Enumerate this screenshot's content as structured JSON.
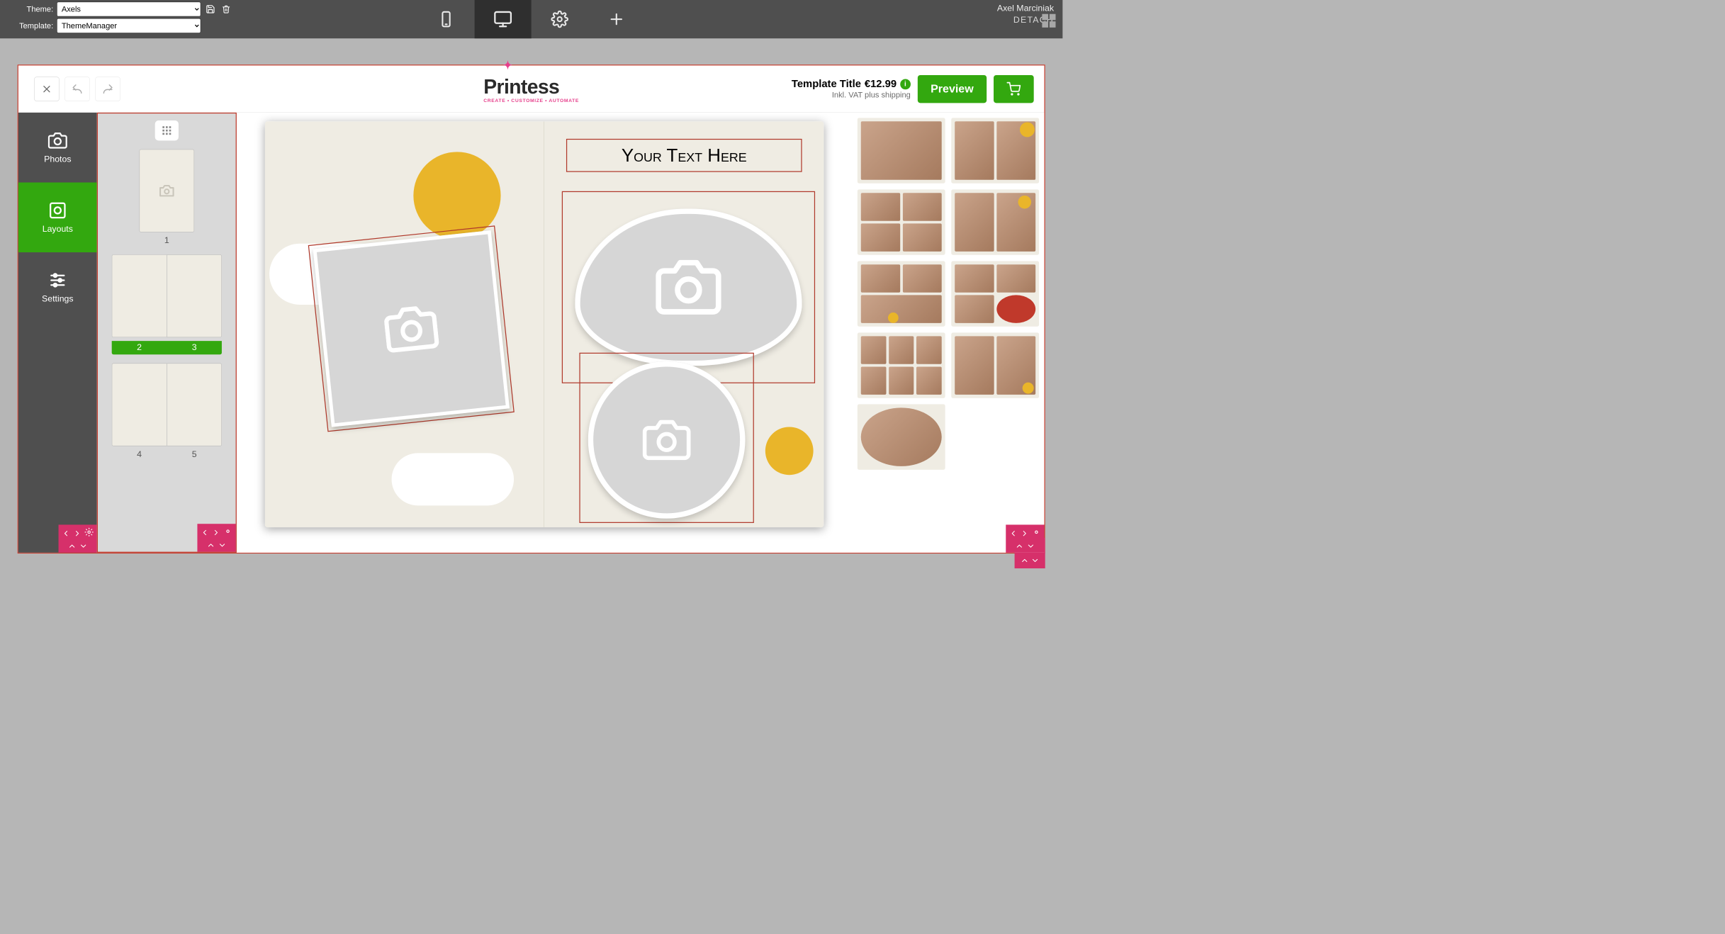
{
  "topbar": {
    "theme_label": "Theme:",
    "theme_value": "Axels",
    "template_label": "Template:",
    "template_value": "ThemeManager",
    "user_name": "Axel Marciniak",
    "detach_label": "DETACH"
  },
  "header": {
    "logo_text": "Printess",
    "logo_sub": "CREATE • CUSTOMIZE • AUTOMATE",
    "title": "Template Title",
    "price": "€12.99",
    "vat": "Inkl. VAT plus shipping",
    "preview_label": "Preview"
  },
  "sidebar": {
    "items": [
      {
        "id": "photos",
        "label": "Photos"
      },
      {
        "id": "layouts",
        "label": "Layouts"
      },
      {
        "id": "settings",
        "label": "Settings"
      }
    ],
    "active": "layouts"
  },
  "pages": [
    {
      "numbers": [
        "1"
      ],
      "type": "single",
      "active": false
    },
    {
      "numbers": [
        "2",
        "3"
      ],
      "type": "spread",
      "active": true
    },
    {
      "numbers": [
        "4",
        "5"
      ],
      "type": "spread",
      "active": false
    }
  ],
  "canvas": {
    "text_placeholder": "Your Text Here"
  },
  "colors": {
    "accent_green": "#33a80f",
    "accent_pink": "#d6306a",
    "sun_yellow": "#e9b52a",
    "page_bg": "#efece3",
    "selection_red": "#b0392b"
  }
}
